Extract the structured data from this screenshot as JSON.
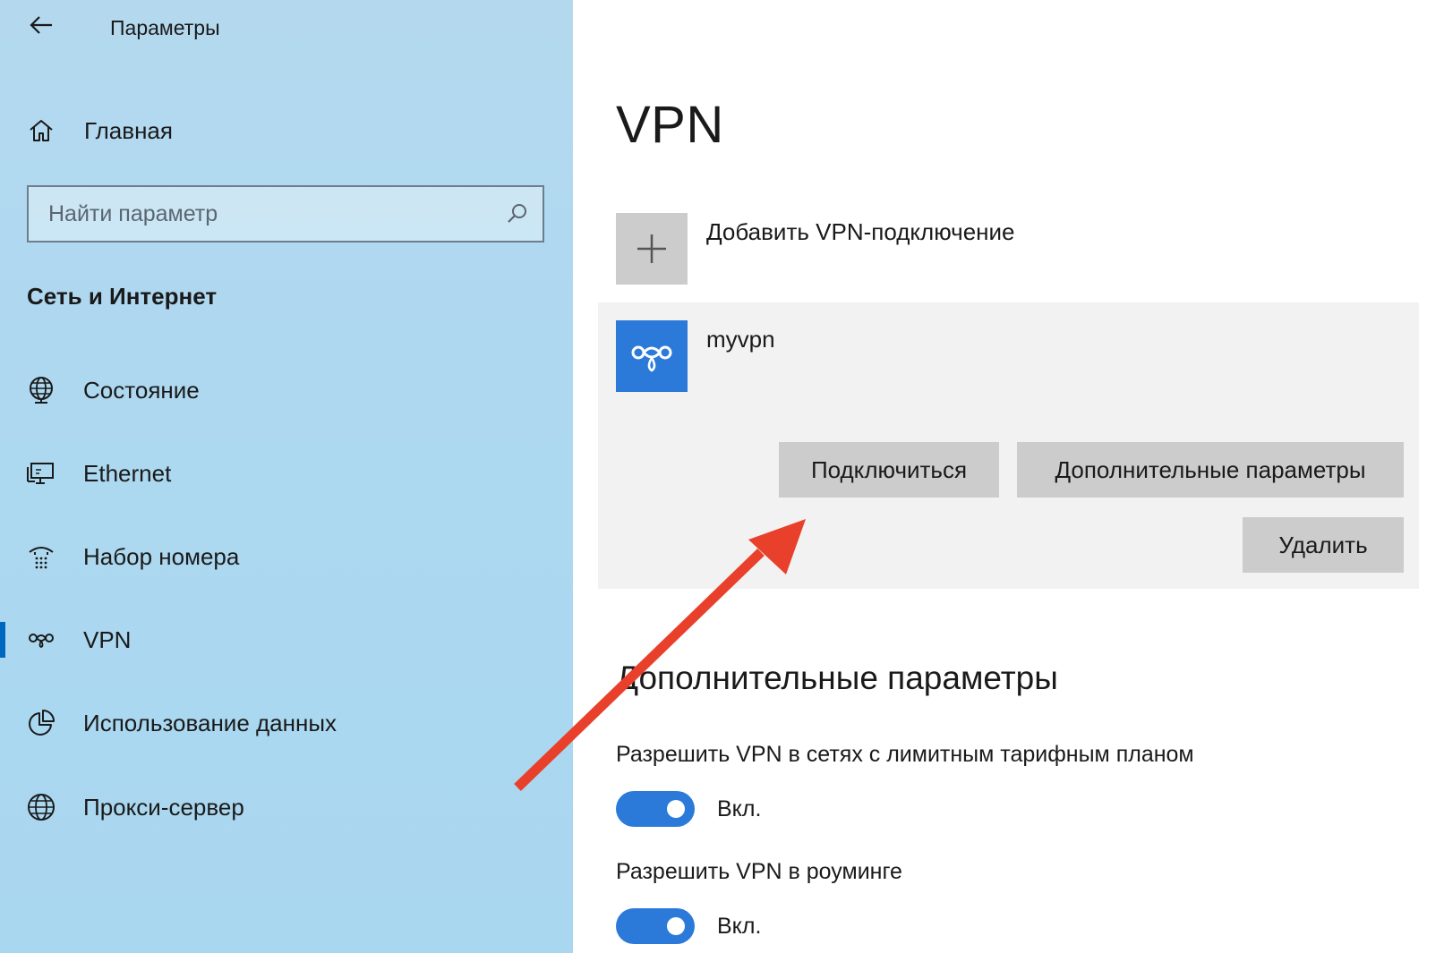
{
  "window": {
    "title": "Параметры"
  },
  "sidebar": {
    "home_label": "Главная",
    "search": {
      "placeholder": "Найти параметр",
      "value": ""
    },
    "section_title": "Сеть и Интернет",
    "items": [
      {
        "label": "Состояние",
        "icon": "globe-status-icon"
      },
      {
        "label": "Ethernet",
        "icon": "ethernet-monitor-icon"
      },
      {
        "label": "Набор номера",
        "icon": "dial-up-icon"
      },
      {
        "label": "VPN",
        "icon": "vpn-icon",
        "active": true
      },
      {
        "label": "Использование данных",
        "icon": "data-usage-icon"
      },
      {
        "label": "Прокси-сервер",
        "icon": "globe-icon"
      }
    ]
  },
  "main": {
    "title": "VPN",
    "add_vpn_label": "Добавить VPN-подключение",
    "connection": {
      "name": "myvpn",
      "connect_label": "Подключиться",
      "advanced_label": "Дополнительные параметры",
      "delete_label": "Удалить"
    },
    "advanced": {
      "title": "Дополнительные параметры",
      "settings": [
        {
          "label": "Разрешить VPN в сетях с лимитным тарифным планом",
          "state": "Вкл.",
          "on": true
        },
        {
          "label": "Разрешить VPN в роуминге",
          "state": "Вкл.",
          "on": true
        }
      ]
    }
  },
  "colors": {
    "sidebar_bg": "#acd8f0",
    "accent": "#2b7ad9",
    "button_bg": "#cccccc",
    "card_bg": "#f2f2f2",
    "annotation_arrow": "#e8402a"
  }
}
